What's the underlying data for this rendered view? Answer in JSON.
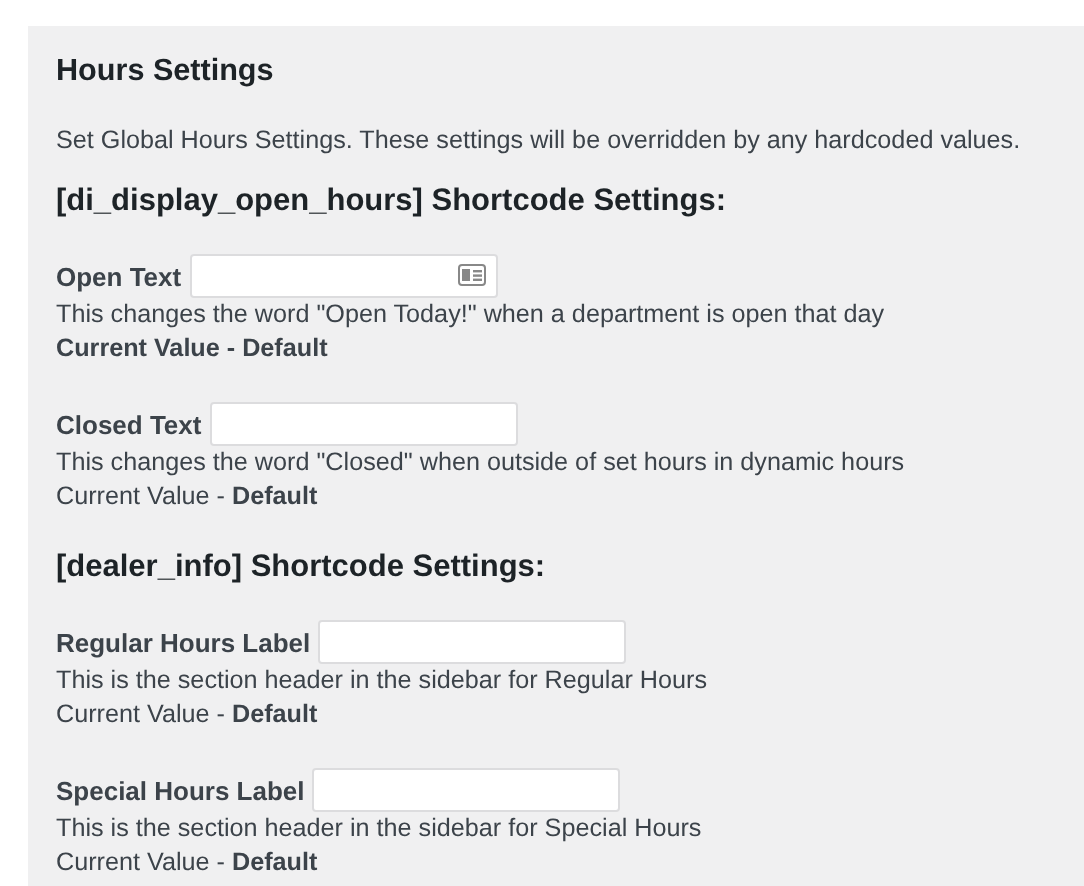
{
  "title": "Hours Settings",
  "intro": "Set Global Hours Settings. These settings will be overridden by any hardcoded values.",
  "sections": [
    {
      "heading": "[di_display_open_hours] Shortcode Settings:",
      "fields": [
        {
          "label": "Open Text",
          "autofill_icon": true,
          "description": "This changes the word \"Open Today!\" when a department is open that day",
          "current": "Current Value - Default",
          "current_bold": true
        },
        {
          "label": "Closed Text",
          "autofill_icon": false,
          "description": "This changes the word \"Closed\" when outside of set hours in dynamic hours",
          "current": "Current Value - **Default**",
          "current_bold": false
        }
      ]
    },
    {
      "heading": "[dealer_info] Shortcode Settings:",
      "fields": [
        {
          "label": "Regular Hours Label",
          "autofill_icon": false,
          "description": "This is the section header in the sidebar for Regular Hours",
          "current": "Current Value - **Default**",
          "current_bold": false
        },
        {
          "label": "Special Hours Label",
          "autofill_icon": false,
          "description": "This is the section header in the sidebar for Special Hours",
          "current": "Current Value - **Default**",
          "current_bold": false
        }
      ]
    }
  ]
}
